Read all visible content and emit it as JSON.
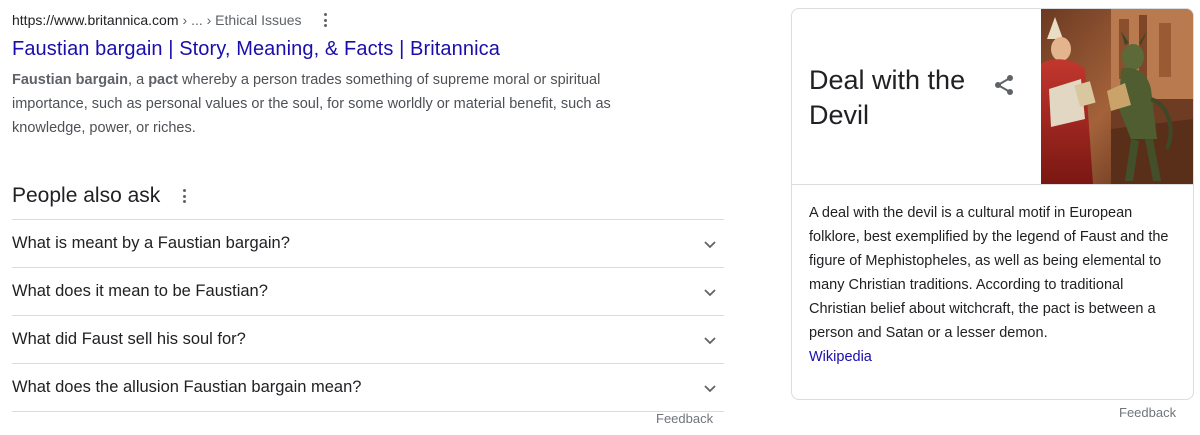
{
  "result": {
    "url": "https://www.britannica.com",
    "path": "› ... › Ethical Issues",
    "title": "Faustian bargain | Story, Meaning, & Facts | Britannica",
    "snippet_bold1": "Faustian bargain",
    "snippet_t1": ", a ",
    "snippet_bold2": "pact",
    "snippet_t2": " whereby a person trades something of supreme moral or spiritual importance, such as personal values or the soul, for some worldly or material benefit, such as knowledge, power, or riches."
  },
  "people_also_ask": {
    "title": "People also ask",
    "questions": [
      "What is meant by a Faustian bargain?",
      "What does it mean to be Faustian?",
      "What did Faust sell his soul for?",
      "What does the allusion Faustian bargain mean?"
    ],
    "feedback": "Feedback"
  },
  "knowledge_panel": {
    "title": "Deal with the Devil",
    "description": "A deal with the devil is a cultural motif in European folklore, best exemplified by the legend of Faust and the figure of Mephistopheles, as well as being elemental to many Christian traditions. According to traditional Christian belief about witchcraft, the pact is between a person and Satan or a lesser demon.",
    "source_link": "Wikipedia",
    "share_icon": "share-icon",
    "feedback": "Feedback"
  },
  "colors": {
    "link": "#1a0dab",
    "text": "#202124",
    "secondary": "#5f6368",
    "divider": "#dadce0"
  }
}
